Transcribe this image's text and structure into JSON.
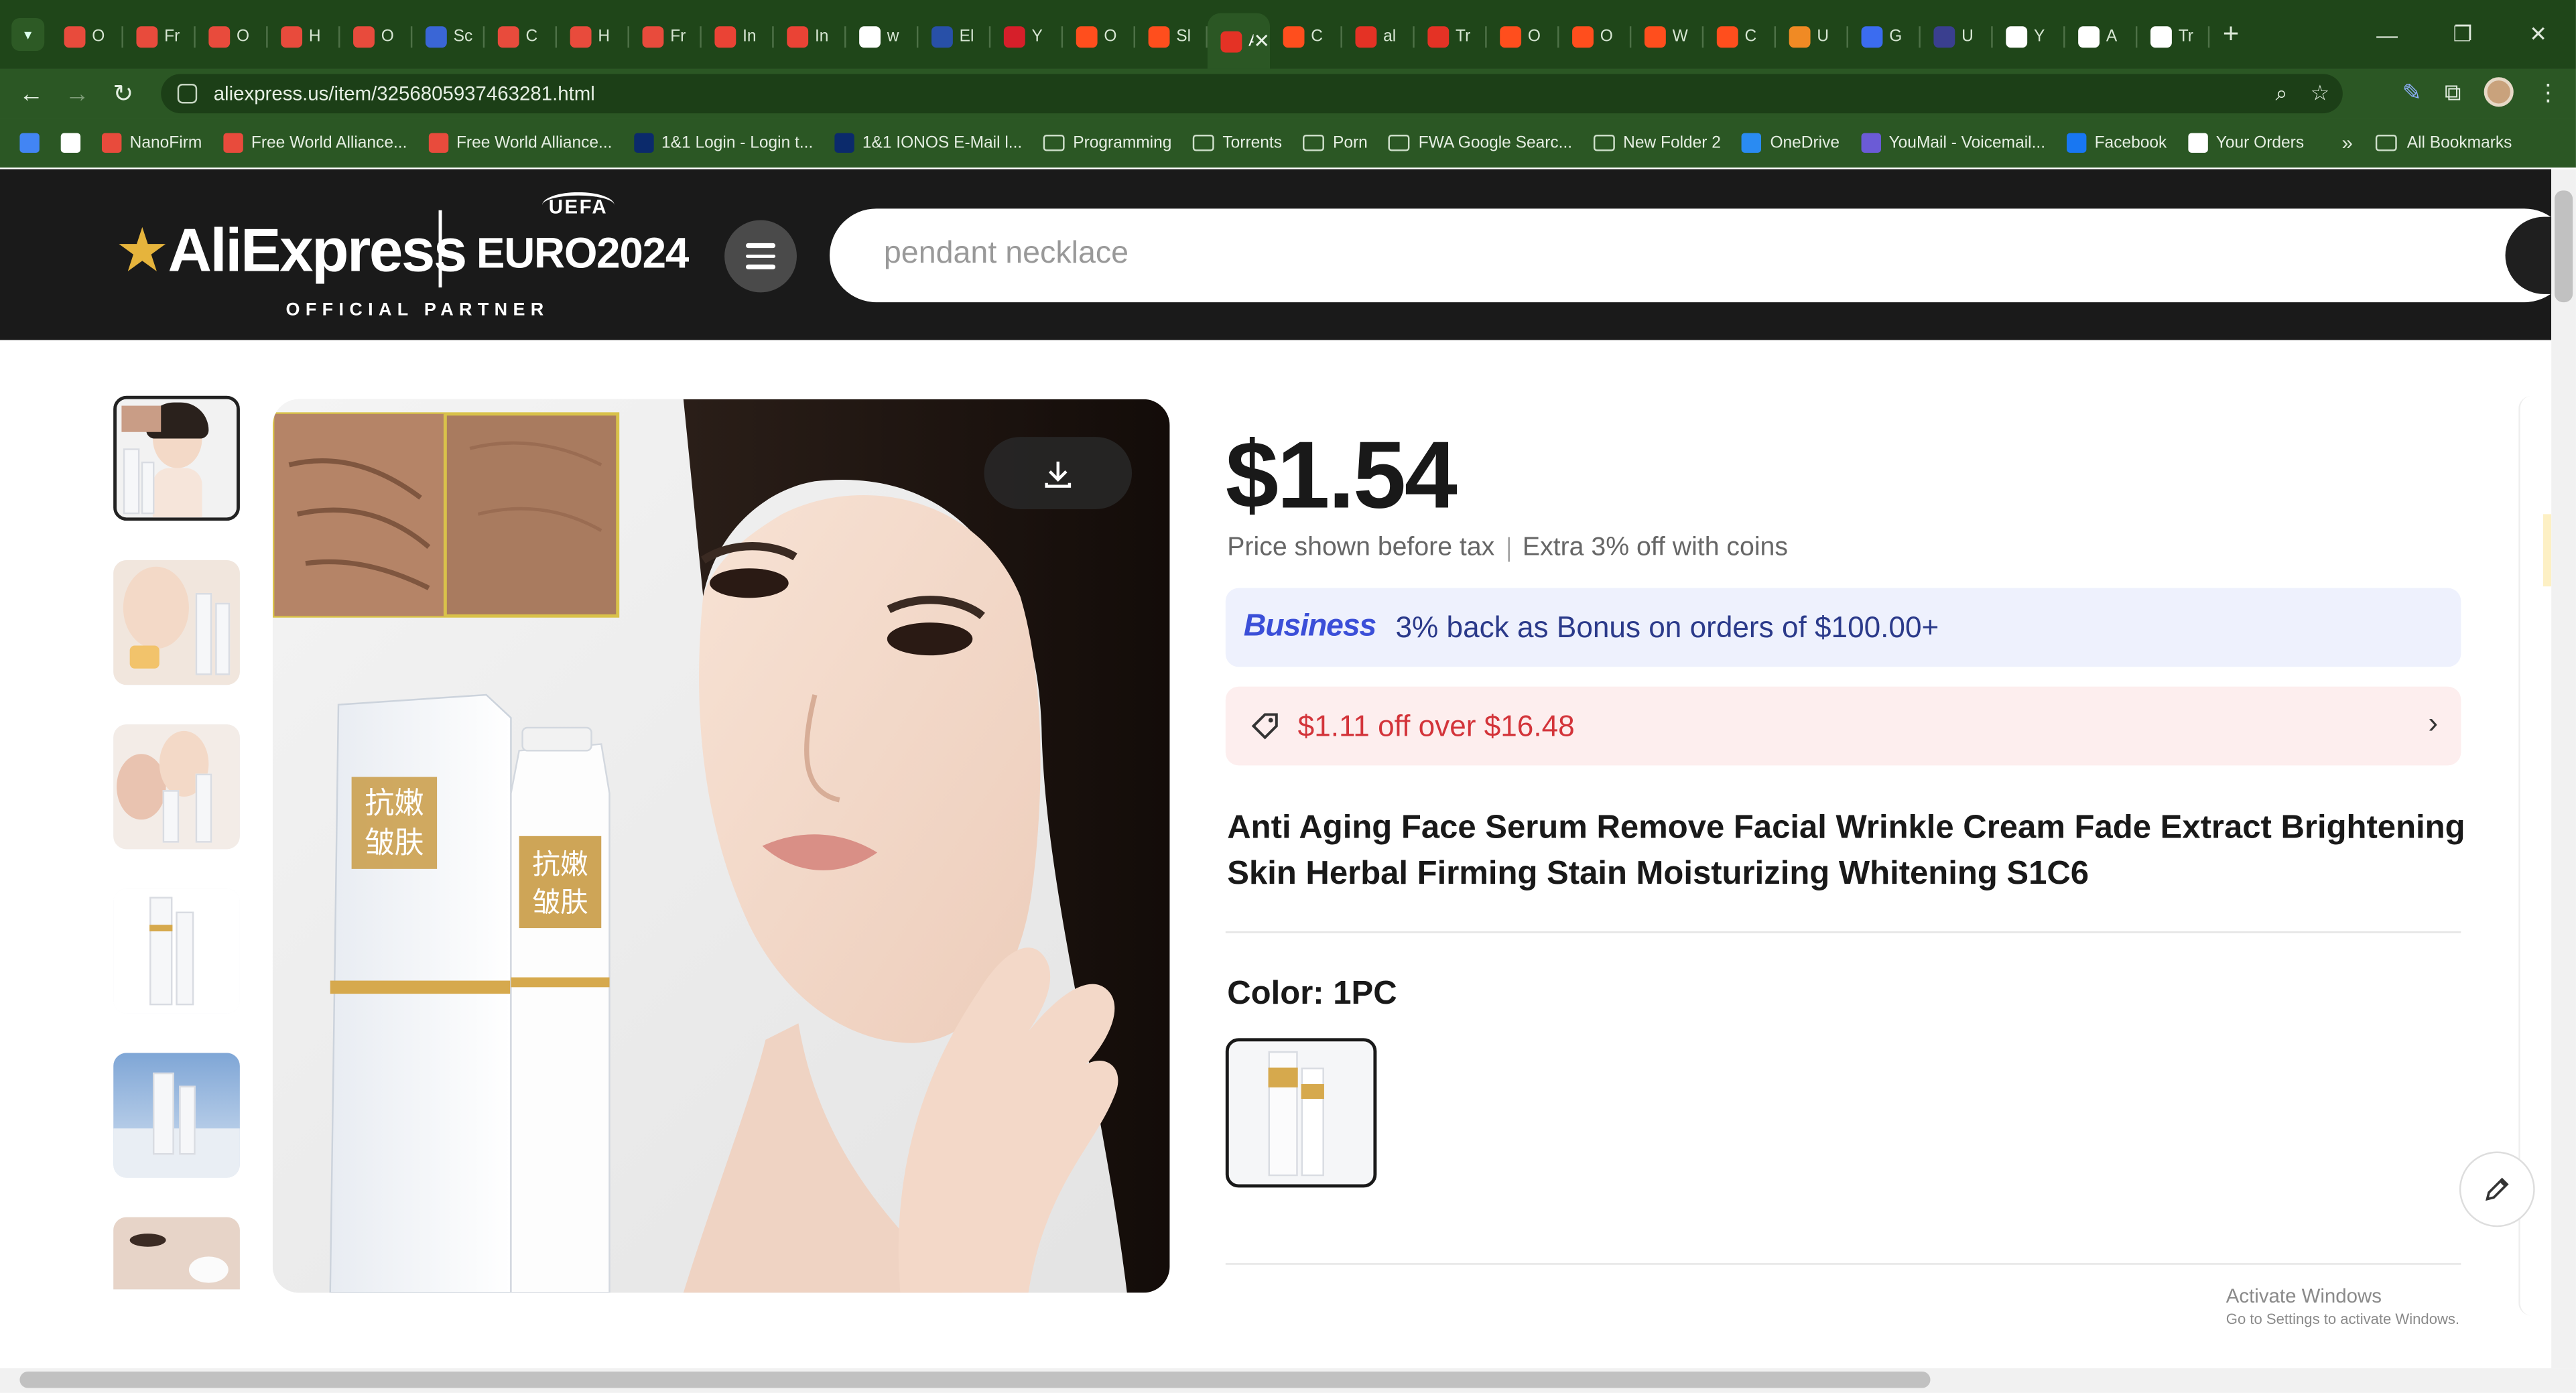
{
  "browser": {
    "tabs": [
      {
        "label": "O",
        "color": "#e84b3c"
      },
      {
        "label": "Fr",
        "color": "#e84b3c"
      },
      {
        "label": "O",
        "color": "#e84b3c"
      },
      {
        "label": "H",
        "color": "#e84b3c"
      },
      {
        "label": "O",
        "color": "#e84b3c"
      },
      {
        "label": "Sc",
        "color": "#3a66d6"
      },
      {
        "label": "C",
        "color": "#e84b3c"
      },
      {
        "label": "H",
        "color": "#e84b3c"
      },
      {
        "label": "Fr",
        "color": "#e84b3c"
      },
      {
        "label": "In",
        "color": "#ea4335"
      },
      {
        "label": "In",
        "color": "#ea4335"
      },
      {
        "label": "w",
        "color": "#ffffff"
      },
      {
        "label": "El",
        "color": "#2850a8"
      },
      {
        "label": "Y",
        "color": "#d61f2a"
      },
      {
        "label": "O",
        "color": "#ff4e1d"
      },
      {
        "label": "Sl",
        "color": "#ff4e1d"
      },
      {
        "label": "A",
        "color": "#e43225",
        "active": true
      },
      {
        "label": "C",
        "color": "#ff4e1d"
      },
      {
        "label": "al",
        "color": "#e43225"
      },
      {
        "label": "Tr",
        "color": "#e43225"
      },
      {
        "label": "O",
        "color": "#ff4e1d"
      },
      {
        "label": "O",
        "color": "#ff4e1d"
      },
      {
        "label": "W",
        "color": "#ff4e1d"
      },
      {
        "label": "C",
        "color": "#ff4e1d"
      },
      {
        "label": "U",
        "color": "#f08a24"
      },
      {
        "label": "G",
        "color": "#3b6cf0"
      },
      {
        "label": "U",
        "color": "#3a3f8f"
      },
      {
        "label": "Y",
        "color": "#ffffff"
      },
      {
        "label": "A",
        "color": "#ffffff"
      },
      {
        "label": "Tr",
        "color": "#ffffff"
      }
    ],
    "url": "aliexpress.us/item/3256805937463281.html",
    "bookmarks": [
      {
        "label": "",
        "kind": "icon",
        "color": "#4285f4"
      },
      {
        "label": "",
        "kind": "icon",
        "color": "#ffffff"
      },
      {
        "label": "NanoFirm",
        "kind": "icon",
        "color": "#e84b3c"
      },
      {
        "label": "Free World Alliance...",
        "kind": "icon",
        "color": "#e84b3c"
      },
      {
        "label": "Free World Alliance...",
        "kind": "icon",
        "color": "#e84b3c"
      },
      {
        "label": "1&1 Login - Login t...",
        "kind": "icon",
        "color": "#0b2a6b"
      },
      {
        "label": "1&1 IONOS E-Mail l...",
        "kind": "icon",
        "color": "#0b2a6b"
      },
      {
        "label": "Programming",
        "kind": "folder"
      },
      {
        "label": "Torrents",
        "kind": "folder"
      },
      {
        "label": "Porn",
        "kind": "folder"
      },
      {
        "label": "FWA Google Searc...",
        "kind": "folder"
      },
      {
        "label": "New Folder 2",
        "kind": "folder"
      },
      {
        "label": "OneDrive",
        "kind": "icon",
        "color": "#2a8bf2"
      },
      {
        "label": "YouMail - Voicemail...",
        "kind": "icon",
        "color": "#6b5bd6"
      },
      {
        "label": "Facebook",
        "kind": "icon",
        "color": "#1877f2"
      },
      {
        "label": "Your Orders",
        "kind": "icon",
        "color": "#ffffff"
      }
    ],
    "all_bookmarks": "All Bookmarks",
    "more_bookmarks": "»"
  },
  "header": {
    "logo": "AliExpress",
    "euro": "EURO2024",
    "uefa": "UEFA",
    "partner": "OFFICIAL PARTNER",
    "search_placeholder": "pendant necklace"
  },
  "product": {
    "price": "$1.54",
    "tax_note": "Price shown before tax",
    "coins_note": "Extra 3% off with coins",
    "business_label": "Business",
    "business_text": "3% back as Bonus on orders of $100.00+",
    "coupon_text": "$1.11 off over $16.48",
    "title": "Anti Aging Face Serum Remove Facial Wrinkle Cream Fade Extract Brightening Skin Herbal Firming Stain Moisturizing Whitening S1C6",
    "color_label": "Color: 1PC",
    "package_text_1": "抗嫩",
    "package_text_2": "皱肤"
  },
  "watermark": {
    "line1": "Activate Windows",
    "line2": "Go to Settings to activate Windows."
  },
  "colors": {
    "browser_frame": "#1f4619",
    "toolbar": "#2b5724",
    "header_bg": "#1a1a1a",
    "coupon_red": "#d3343a",
    "business_blue": "#3b4fd8"
  }
}
